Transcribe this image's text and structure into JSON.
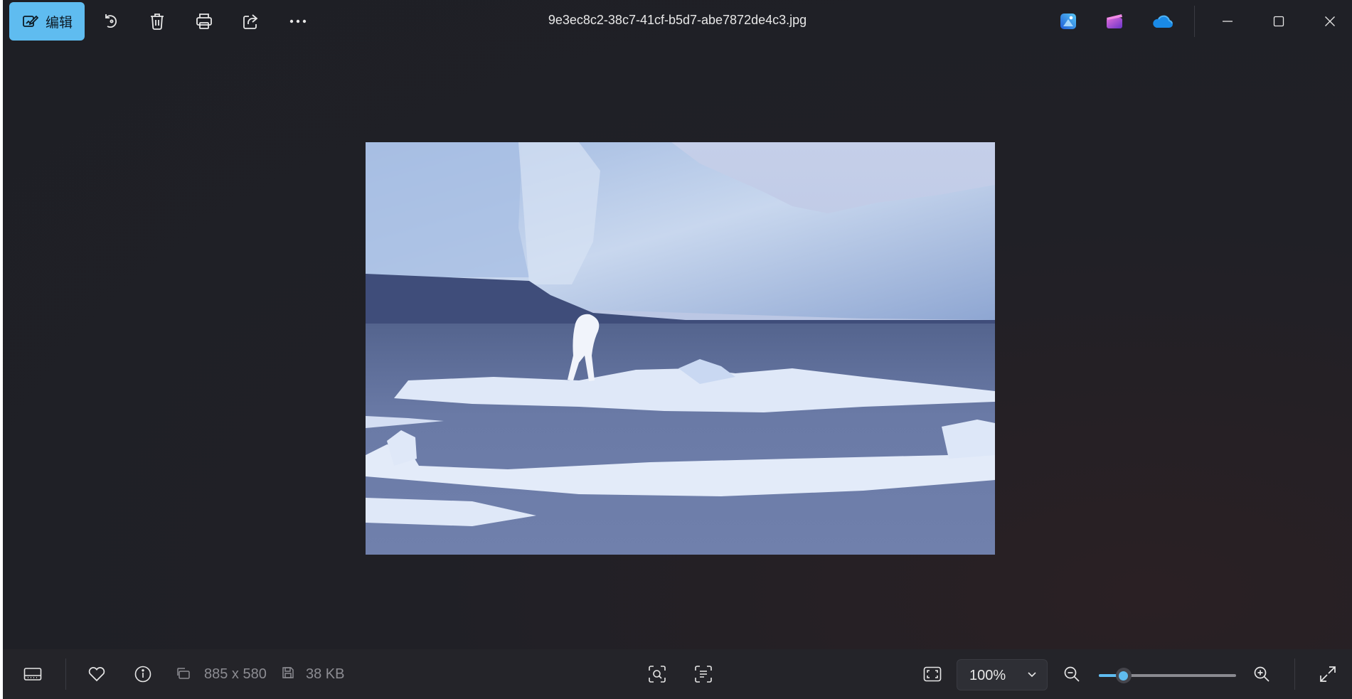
{
  "window": {
    "title": "9e3ec8c2-38c7-41cf-b5d7-abe7872de4c3.jpg"
  },
  "toolbar": {
    "edit_label": "编辑",
    "edit_icon": "edit-image-icon",
    "rotate_icon": "rotate-icon",
    "delete_icon": "delete-icon",
    "print_icon": "print-icon",
    "share_icon": "share-icon",
    "more_icon": "more-options-icon"
  },
  "apps": {
    "designer_icon": "designer-app-icon",
    "clipchamp_icon": "clipchamp-app-icon",
    "onedrive_icon": "onedrive-cloud-icon"
  },
  "window_controls": {
    "minimize_icon": "minimize-icon",
    "maximize_icon": "maximize-icon",
    "close_icon": "close-icon"
  },
  "image": {
    "description_icon": "photo-image"
  },
  "statusbar": {
    "dimensions": "885 x 580",
    "file_size": "38 KB",
    "zoom_value": "100%",
    "zoom_level_fraction": 0.18
  },
  "colors": {
    "accent": "#5fbcf0",
    "background": "#1f1f24",
    "bottombar": "#242429"
  }
}
